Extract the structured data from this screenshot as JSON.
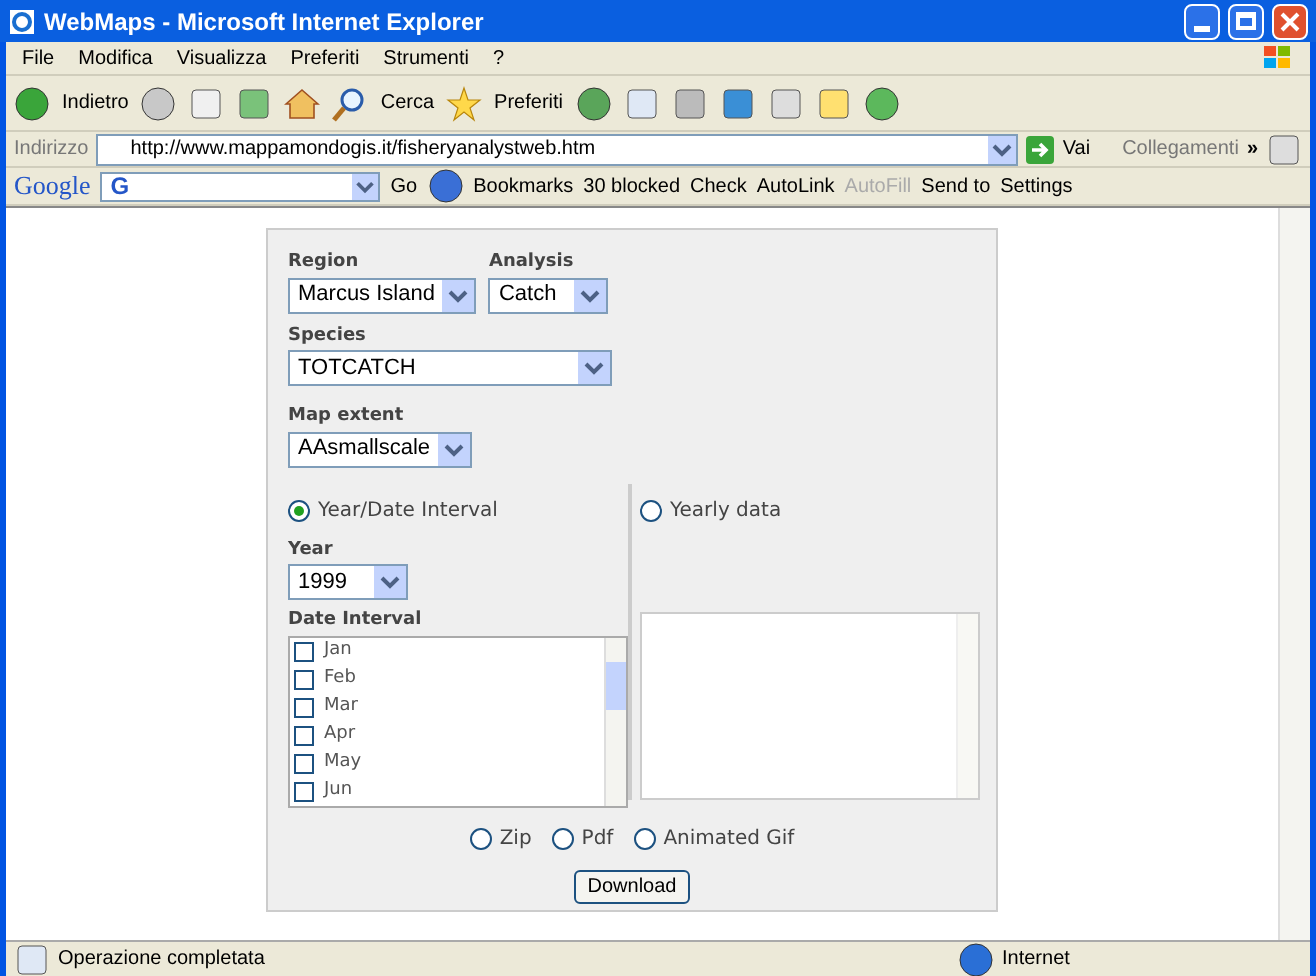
{
  "window": {
    "title": "WebMaps - Microsoft Internet Explorer"
  },
  "menu": [
    {
      "label": "File"
    },
    {
      "label": "Modifica"
    },
    {
      "label": "Visualizza"
    },
    {
      "label": "Preferiti"
    },
    {
      "label": "Strumenti"
    },
    {
      "label": "?"
    }
  ],
  "toolbar": {
    "back": "Indietro",
    "search": "Cerca",
    "favorites": "Preferiti"
  },
  "address_bar": {
    "label": "Indirizzo",
    "url": "http://www.mappamondogis.it/fisheryanalystweb.htm",
    "go": "Vai",
    "links": "Collegamenti",
    "more": "»"
  },
  "google_bar": {
    "logo": "Google",
    "search_logo": "G",
    "go": "Go",
    "items": [
      {
        "label": "Bookmarks",
        "disabled": false
      },
      {
        "label": "30 blocked",
        "disabled": false
      },
      {
        "label": "Check",
        "disabled": false
      },
      {
        "label": "AutoLink",
        "disabled": false
      },
      {
        "label": "AutoFill",
        "disabled": true
      },
      {
        "label": "Send to",
        "disabled": false
      },
      {
        "label": "Settings",
        "disabled": false
      }
    ]
  },
  "form": {
    "region": {
      "label": "Region",
      "value": "Marcus Island"
    },
    "analysis": {
      "label": "Analysis",
      "value": "Catch"
    },
    "species": {
      "label": "Species",
      "value": "TOTCATCH"
    },
    "map_extent": {
      "label": "Map extent",
      "value": "AAsmallscale"
    },
    "modes": [
      {
        "label": "Year/Date Interval",
        "selected": true
      },
      {
        "label": "Yearly data",
        "selected": false
      }
    ],
    "year": {
      "label": "Year",
      "value": "1999"
    },
    "date_interval": {
      "label": "Date Interval",
      "items": [
        {
          "label": "Jan",
          "checked": false
        },
        {
          "label": "Feb",
          "checked": false
        },
        {
          "label": "Mar",
          "checked": false
        },
        {
          "label": "Apr",
          "checked": false
        },
        {
          "label": "May",
          "checked": false
        },
        {
          "label": "Jun",
          "checked": false
        }
      ]
    },
    "formats": [
      {
        "label": "Zip",
        "selected": false
      },
      {
        "label": "Pdf",
        "selected": false
      },
      {
        "label": "Animated Gif",
        "selected": false
      }
    ],
    "download": "Download"
  },
  "status_bar": {
    "message": "Operazione completata",
    "zone": "Internet"
  }
}
